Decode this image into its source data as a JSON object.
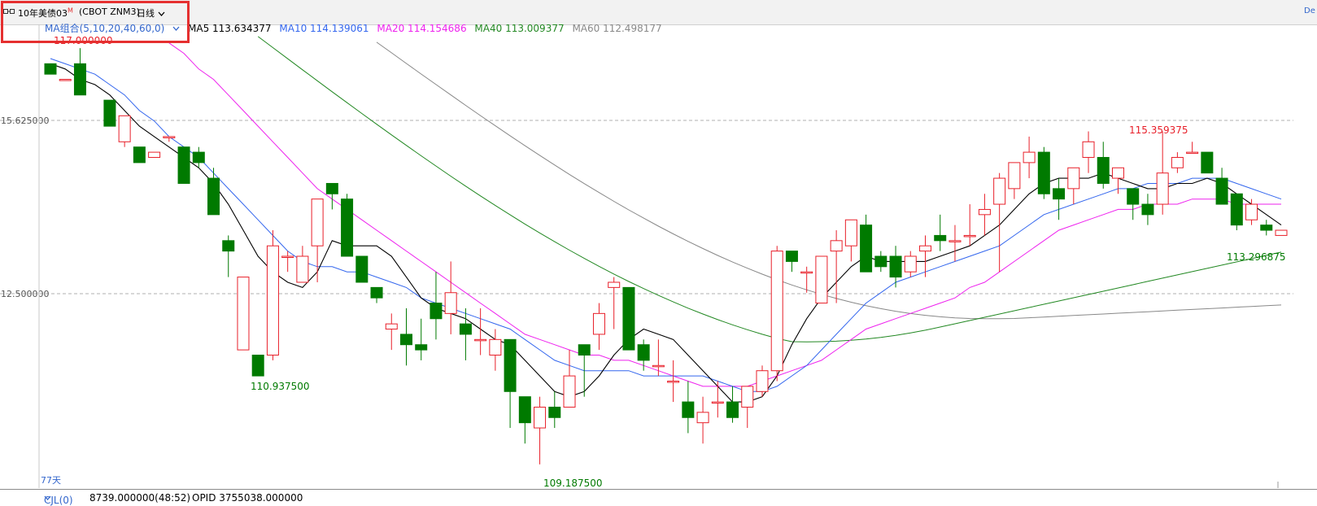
{
  "header": {
    "symbol": "10年美债03",
    "symbol_sup": "M",
    "code": "(CBOT ZNM3)",
    "period": "日线",
    "period_icon": "chevron-down-icon",
    "right_label": "De"
  },
  "ma_legend": {
    "group": "MA组合(5,10,20,40,60,0)",
    "ma5": "MA5 113.634377",
    "ma10": "MA10 114.139061",
    "ma20": "MA20 114.154686",
    "ma40": "MA40 113.009377",
    "ma60": "MA60 112.498177",
    "colors": {
      "group": "#3366cc",
      "ma5": "#000000",
      "ma10": "#3366ee",
      "ma20": "#ee22ee",
      "ma40": "#228822",
      "ma60": "#888888"
    }
  },
  "axis": {
    "y_labels": [
      "15.625000",
      "12.500000"
    ],
    "days_label": "77天"
  },
  "annotations": {
    "top_high": "117.000000",
    "low1": "110.937500",
    "low2": "109.187500",
    "high_right": "115.359375",
    "low_right": "113.296875"
  },
  "bottom": {
    "indicator": "CJL(0)",
    "volume": "8739.000000(48:52)",
    "opid": "OPID 3755038.000000"
  },
  "colors": {
    "up": "#e8202a",
    "down": "#007a00",
    "grid": "#b0b0b0"
  },
  "chart_data": {
    "type": "candlestick",
    "ylim": [
      108.9,
      117.5
    ],
    "candles": [
      [
        116.9,
        116.9,
        116.7,
        116.7
      ],
      [
        116.6,
        116.6,
        116.6,
        116.6
      ],
      [
        116.9,
        117.2,
        116.4,
        116.3
      ],
      [
        null,
        null,
        null,
        null
      ],
      [
        116.2,
        116.2,
        115.7,
        115.7
      ],
      [
        115.4,
        115.9,
        115.3,
        115.9
      ],
      [
        115.3,
        115.3,
        115.0,
        115.0
      ],
      [
        115.1,
        115.2,
        115.1,
        115.2
      ],
      [
        115.5,
        115.5,
        115.4,
        115.5
      ],
      [
        115.3,
        115.3,
        114.6,
        114.6
      ],
      [
        115.2,
        115.3,
        114.9,
        115.0
      ],
      [
        114.7,
        114.9,
        114.0,
        114.0
      ],
      [
        113.5,
        113.6,
        112.8,
        113.3
      ],
      [
        111.4,
        112.8,
        111.4,
        112.8
      ],
      [
        111.3,
        111.3,
        110.9,
        110.9
      ],
      [
        111.3,
        113.7,
        111.2,
        113.4
      ],
      [
        113.2,
        113.3,
        112.9,
        113.2
      ],
      [
        112.7,
        113.4,
        112.7,
        113.2
      ],
      [
        113.4,
        114.0,
        112.7,
        114.3
      ],
      [
        114.6,
        114.6,
        114.1,
        114.4
      ],
      [
        114.3,
        114.4,
        113.2,
        113.2
      ],
      [
        113.2,
        113.2,
        112.8,
        112.7
      ],
      [
        112.6,
        112.6,
        112.3,
        112.4
      ],
      [
        111.8,
        112.1,
        111.4,
        111.9
      ],
      [
        111.7,
        112.2,
        111.1,
        111.5
      ],
      [
        111.5,
        112.0,
        111.2,
        111.4
      ],
      [
        112.3,
        112.9,
        111.6,
        112.0
      ],
      [
        112.1,
        113.1,
        111.7,
        112.5
      ],
      [
        111.9,
        112.2,
        111.2,
        111.7
      ],
      [
        111.6,
        112.2,
        111.3,
        111.6
      ],
      [
        111.3,
        111.8,
        111.0,
        111.6
      ],
      [
        111.6,
        111.6,
        109.9,
        110.6
      ],
      [
        110.5,
        110.5,
        109.6,
        110.0
      ],
      [
        109.9,
        110.5,
        109.2,
        110.3
      ],
      [
        110.3,
        110.6,
        109.9,
        110.1
      ],
      [
        110.3,
        111.4,
        110.3,
        110.9
      ],
      [
        111.5,
        111.5,
        110.5,
        111.3
      ],
      [
        111.7,
        112.3,
        111.4,
        112.1
      ],
      [
        112.6,
        112.8,
        111.8,
        112.7
      ],
      [
        112.6,
        112.6,
        111.6,
        111.4
      ],
      [
        111.5,
        111.6,
        111.0,
        111.2
      ],
      [
        111.1,
        111.6,
        110.9,
        111.1
      ],
      [
        110.8,
        111.2,
        110.4,
        110.8
      ],
      [
        110.4,
        110.8,
        109.8,
        110.1
      ],
      [
        110.0,
        110.5,
        109.6,
        110.2
      ],
      [
        110.4,
        110.8,
        110.1,
        110.4
      ],
      [
        110.4,
        110.7,
        110.0,
        110.1
      ],
      [
        110.3,
        110.7,
        109.9,
        110.7
      ],
      [
        110.6,
        111.1,
        110.5,
        111.0
      ],
      [
        111.0,
        113.4,
        110.8,
        113.3
      ],
      [
        113.3,
        113.3,
        112.9,
        113.1
      ],
      [
        112.9,
        113.0,
        112.5,
        112.9
      ],
      [
        112.3,
        113.0,
        112.3,
        113.2
      ],
      [
        113.3,
        113.7,
        112.3,
        113.5
      ],
      [
        113.4,
        113.8,
        113.1,
        113.9
      ],
      [
        113.8,
        114.0,
        112.9,
        112.9
      ],
      [
        113.2,
        113.3,
        112.9,
        113.0
      ],
      [
        113.2,
        113.4,
        112.6,
        112.8
      ],
      [
        112.9,
        113.3,
        112.8,
        113.2
      ],
      [
        113.3,
        113.6,
        112.8,
        113.4
      ],
      [
        113.6,
        114.0,
        113.3,
        113.5
      ],
      [
        113.5,
        113.8,
        113.1,
        113.5
      ],
      [
        113.6,
        114.2,
        113.4,
        113.6
      ],
      [
        114.0,
        114.4,
        113.6,
        114.1
      ],
      [
        114.2,
        114.8,
        112.9,
        114.7
      ],
      [
        114.5,
        115.0,
        114.3,
        115.0
      ],
      [
        115.0,
        115.5,
        114.7,
        115.2
      ],
      [
        115.2,
        115.3,
        114.3,
        114.4
      ],
      [
        114.5,
        114.7,
        113.9,
        114.3
      ],
      [
        114.5,
        114.9,
        114.2,
        114.9
      ],
      [
        115.1,
        115.6,
        114.8,
        115.4
      ],
      [
        115.1,
        115.4,
        114.5,
        114.6
      ],
      [
        114.7,
        114.9,
        114.4,
        114.9
      ],
      [
        114.5,
        114.5,
        113.9,
        114.2
      ],
      [
        114.2,
        114.4,
        113.8,
        114.0
      ],
      [
        114.2,
        115.6,
        114.0,
        114.8
      ],
      [
        114.9,
        115.2,
        114.8,
        115.1
      ],
      [
        115.2,
        115.4,
        115.2,
        115.2
      ],
      [
        115.2,
        115.2,
        114.8,
        114.8
      ],
      [
        114.7,
        114.9,
        114.5,
        114.2
      ],
      [
        114.4,
        114.4,
        113.7,
        113.8
      ],
      [
        113.9,
        114.3,
        113.8,
        114.2
      ],
      [
        113.8,
        113.9,
        113.6,
        113.7
      ],
      [
        113.6,
        113.7,
        113.6,
        113.7
      ]
    ],
    "ma5": [
      116.9,
      116.8,
      116.6,
      116.5,
      116.3,
      116.0,
      115.7,
      115.5,
      115.3,
      115.1,
      114.9,
      114.6,
      114.2,
      113.7,
      113.2,
      112.9,
      112.7,
      112.6,
      112.9,
      113.5,
      113.4,
      113.4,
      113.4,
      113.2,
      112.8,
      112.4,
      112.2,
      112.1,
      112.0,
      111.8,
      111.6,
      111.5,
      111.2,
      110.9,
      110.6,
      110.5,
      110.6,
      110.9,
      111.3,
      111.6,
      111.8,
      111.7,
      111.6,
      111.3,
      111.0,
      110.7,
      110.4,
      110.4,
      110.5,
      110.9,
      111.5,
      112.0,
      112.4,
      112.7,
      113.0,
      113.2,
      113.1,
      113.1,
      113.1,
      113.1,
      113.2,
      113.3,
      113.4,
      113.6,
      113.8,
      114.1,
      114.4,
      114.6,
      114.7,
      114.7,
      114.7,
      114.8,
      114.7,
      114.6,
      114.5,
      114.5,
      114.6,
      114.6,
      114.7,
      114.6,
      114.4,
      114.2,
      114.0,
      113.8
    ],
    "ma10": [
      117.0,
      116.9,
      116.8,
      116.7,
      116.5,
      116.3,
      116.0,
      115.8,
      115.5,
      115.3,
      115.1,
      114.8,
      114.5,
      114.2,
      113.9,
      113.6,
      113.3,
      113.1,
      113.0,
      113.0,
      112.9,
      112.9,
      112.8,
      112.7,
      112.6,
      112.4,
      112.3,
      112.2,
      112.1,
      112.0,
      111.9,
      111.8,
      111.6,
      111.4,
      111.2,
      111.1,
      111.0,
      111.0,
      111.0,
      111.0,
      110.9,
      110.9,
      110.9,
      110.9,
      110.9,
      110.8,
      110.7,
      110.6,
      110.6,
      110.7,
      110.9,
      111.1,
      111.4,
      111.7,
      112.0,
      112.3,
      112.5,
      112.7,
      112.8,
      112.9,
      113.0,
      113.1,
      113.2,
      113.3,
      113.4,
      113.6,
      113.8,
      114.0,
      114.1,
      114.2,
      114.3,
      114.4,
      114.5,
      114.5,
      114.6,
      114.6,
      114.6,
      114.7,
      114.7,
      114.7,
      114.6,
      114.5,
      114.4,
      114.3
    ],
    "ma20": [
      null,
      null,
      null,
      null,
      null,
      null,
      null,
      null,
      117.3,
      117.1,
      116.8,
      116.6,
      116.3,
      116.0,
      115.7,
      115.4,
      115.1,
      114.8,
      114.5,
      114.3,
      114.1,
      113.9,
      113.7,
      113.5,
      113.3,
      113.1,
      112.9,
      112.7,
      112.5,
      112.3,
      112.1,
      111.9,
      111.7,
      111.6,
      111.5,
      111.4,
      111.3,
      111.3,
      111.2,
      111.2,
      111.1,
      111.0,
      110.9,
      110.8,
      110.7,
      110.7,
      110.7,
      110.7,
      110.8,
      110.9,
      111.0,
      111.1,
      111.2,
      111.4,
      111.6,
      111.8,
      111.9,
      112.0,
      112.1,
      112.2,
      112.3,
      112.4,
      112.6,
      112.7,
      112.9,
      113.1,
      113.3,
      113.5,
      113.7,
      113.8,
      113.9,
      114.0,
      114.1,
      114.1,
      114.2,
      114.2,
      114.2,
      114.3,
      114.3,
      114.3,
      114.2,
      114.2,
      114.2,
      114.2
    ]
  }
}
